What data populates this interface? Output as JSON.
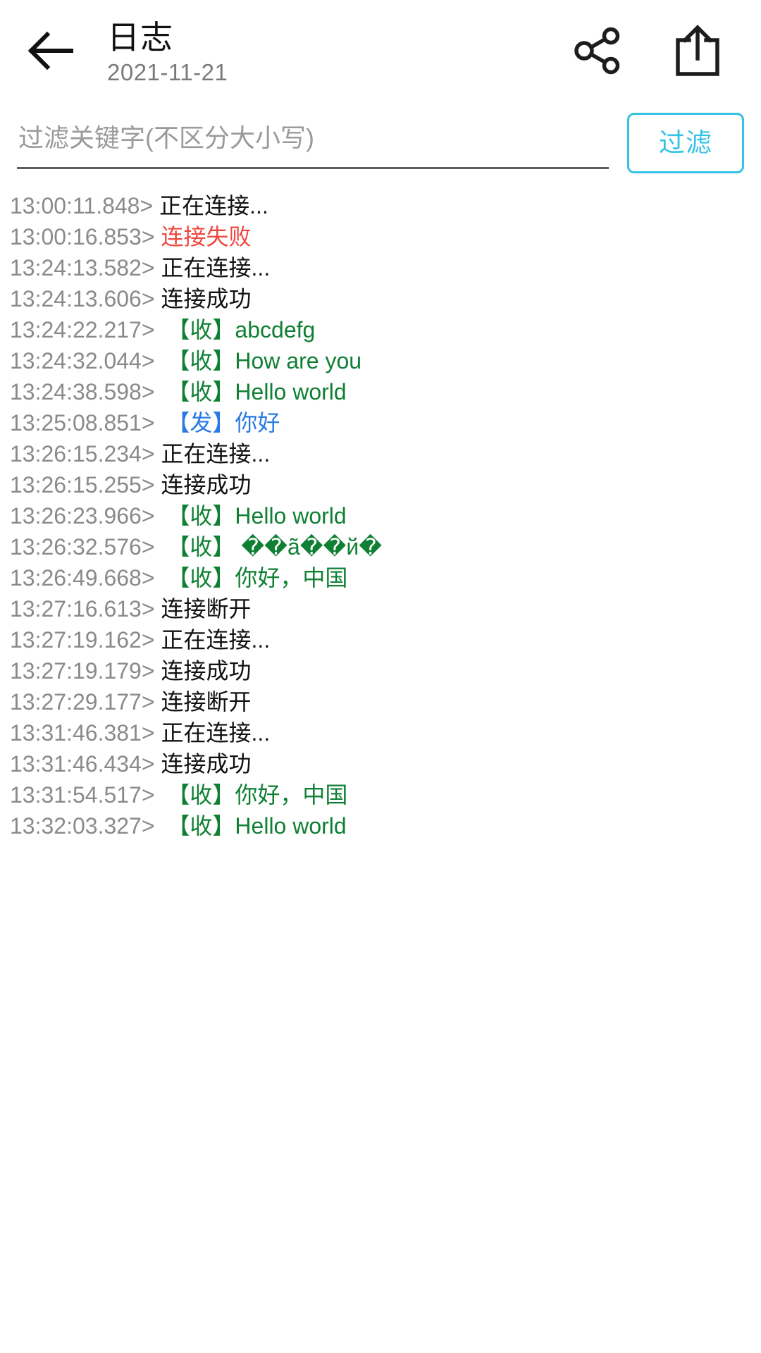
{
  "header": {
    "back_icon": "arrow-left-icon",
    "title": "日志",
    "subtitle": "2021-11-21",
    "share_icon": "share-nodes-icon",
    "export_icon": "export-upload-icon"
  },
  "filter": {
    "placeholder": "过滤关键字(不区分大小写)",
    "value": "",
    "button_label": "过滤",
    "accent_color": "#34c3e4"
  },
  "colors": {
    "info": "#111111",
    "error": "#f0473f",
    "received": "#0f8033",
    "sent": "#2a7ae4",
    "timestamp": "#8a8a8a"
  },
  "log": {
    "entries": [
      {
        "time": "13:00:11.848>",
        "message": "正在连接...",
        "kind": "info"
      },
      {
        "time": "13:00:16.853>",
        "message": "连接失败",
        "kind": "error"
      },
      {
        "time": "13:24:13.582>",
        "message": "正在连接...",
        "kind": "info"
      },
      {
        "time": "13:24:13.606>",
        "message": "连接成功",
        "kind": "info"
      },
      {
        "time": "13:24:22.217>",
        "message": " 【收】abcdefg",
        "kind": "recv"
      },
      {
        "time": "13:24:32.044>",
        "message": " 【收】How are you",
        "kind": "recv"
      },
      {
        "time": "13:24:38.598>",
        "message": " 【收】Hello world",
        "kind": "recv"
      },
      {
        "time": "13:25:08.851>",
        "message": " 【发】你好",
        "kind": "send"
      },
      {
        "time": "13:26:15.234>",
        "message": "正在连接...",
        "kind": "info"
      },
      {
        "time": "13:26:15.255>",
        "message": "连接成功",
        "kind": "info"
      },
      {
        "time": "13:26:23.966>",
        "message": " 【收】Hello world",
        "kind": "recv"
      },
      {
        "time": "13:26:32.576>",
        "message": " 【收】 ��ã��й�",
        "kind": "recv"
      },
      {
        "time": "13:26:49.668>",
        "message": " 【收】你好，中国",
        "kind": "recv"
      },
      {
        "time": "13:27:16.613>",
        "message": "连接断开",
        "kind": "info"
      },
      {
        "time": "13:27:19.162>",
        "message": "正在连接...",
        "kind": "info"
      },
      {
        "time": "13:27:19.179>",
        "message": "连接成功",
        "kind": "info"
      },
      {
        "time": "13:27:29.177>",
        "message": "连接断开",
        "kind": "info"
      },
      {
        "time": "13:31:46.381>",
        "message": "正在连接...",
        "kind": "info"
      },
      {
        "time": "13:31:46.434>",
        "message": "连接成功",
        "kind": "info"
      },
      {
        "time": "13:31:54.517>",
        "message": " 【收】你好，中国",
        "kind": "recv"
      },
      {
        "time": "13:32:03.327>",
        "message": " 【收】Hello world",
        "kind": "recv"
      }
    ]
  }
}
